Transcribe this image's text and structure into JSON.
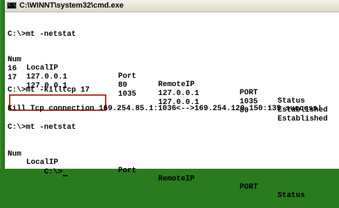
{
  "window": {
    "title": "C:\\WINNT\\system32\\cmd.exe",
    "icon_name": "console-app-icon",
    "icon_glyph": "C:\\"
  },
  "console": {
    "cmd1": "C:\\>mt -netstat",
    "table1": {
      "headers": [
        "Num",
        "LocalIP",
        "Port",
        "RemoteIP",
        "PORT",
        "Status"
      ],
      "rows": [
        [
          "16",
          "127.0.0.1",
          "80",
          "127.0.0.1",
          "1035",
          "Established"
        ],
        [
          "17",
          "127.0.0.1",
          "1035",
          "127.0.0.1",
          "80",
          "Established"
        ]
      ]
    },
    "cmd2": "C:\\>mt -killtcp 17",
    "result": "Kill Tcp connection 169.254.85.1:1036<-->169.254.120.150:139 success!",
    "cmd3": "C:\\>mt -netstat",
    "table2": {
      "headers": [
        "Num",
        "LocalIP",
        "Port",
        "RemoteIP",
        "PORT",
        "Status"
      ]
    },
    "prompt": "C:\\>"
  },
  "colors": {
    "highlight": "#b02a2a",
    "background": "#2a7a1f"
  }
}
